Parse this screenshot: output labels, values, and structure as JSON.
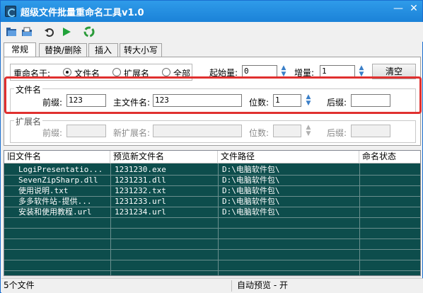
{
  "window": {
    "title": "超级文件批量重命名工具v1.0",
    "min_label": "—",
    "close_label": "✕"
  },
  "toolbar": {
    "icons": [
      "open-folder-icon",
      "open-file-icon",
      "undo-icon",
      "run-icon",
      "recycle-icon"
    ]
  },
  "tabs": [
    "常规",
    "替换/删除",
    "插入",
    "转大小写"
  ],
  "rename": {
    "label": "重命名于:",
    "options": [
      "文件名",
      "扩展名",
      "全部"
    ],
    "selected": 0,
    "start_label": "起始量:",
    "start_value": "0",
    "step_label": "增量:",
    "step_value": "1",
    "clear_label": "清空"
  },
  "filename_group": {
    "title": "文件名",
    "prefix_label": "前缀:",
    "prefix_value": "123",
    "main_label": "主文件名:",
    "main_value": "123",
    "digits_label": "位数:",
    "digits_value": "1",
    "suffix_label": "后缀:",
    "suffix_value": ""
  },
  "ext_group": {
    "title": "扩展名",
    "prefix_label": "前缀:",
    "newext_label": "新扩展名:",
    "digits_label": "位数:",
    "suffix_label": "后缀:"
  },
  "table": {
    "columns": [
      "旧文件名",
      "预览新文件名",
      "文件路径",
      "命名状态"
    ],
    "rows": [
      {
        "old": "LogiPresentatio...",
        "new": "1231230.exe",
        "path": "D:\\电脑软件包\\",
        "status": ""
      },
      {
        "old": "SevenZipSharp.dll",
        "new": "1231231.dll",
        "path": "D:\\电脑软件包\\",
        "status": ""
      },
      {
        "old": "使用说明.txt",
        "new": "1231232.txt",
        "path": "D:\\电脑软件包\\",
        "status": ""
      },
      {
        "old": "多多软件站-提供...",
        "new": "1231233.url",
        "path": "D:\\电脑软件包\\",
        "status": ""
      },
      {
        "old": "安装和使用教程.url",
        "new": "1231234.url",
        "path": "D:\\电脑软件包\\",
        "status": ""
      }
    ]
  },
  "status": {
    "count": "5个文件",
    "preview": "自动预览 - 开"
  },
  "colors": {
    "title_bar": "#1b82d8",
    "grid_bg": "#0d4d4c",
    "highlight": "#e0302f"
  }
}
